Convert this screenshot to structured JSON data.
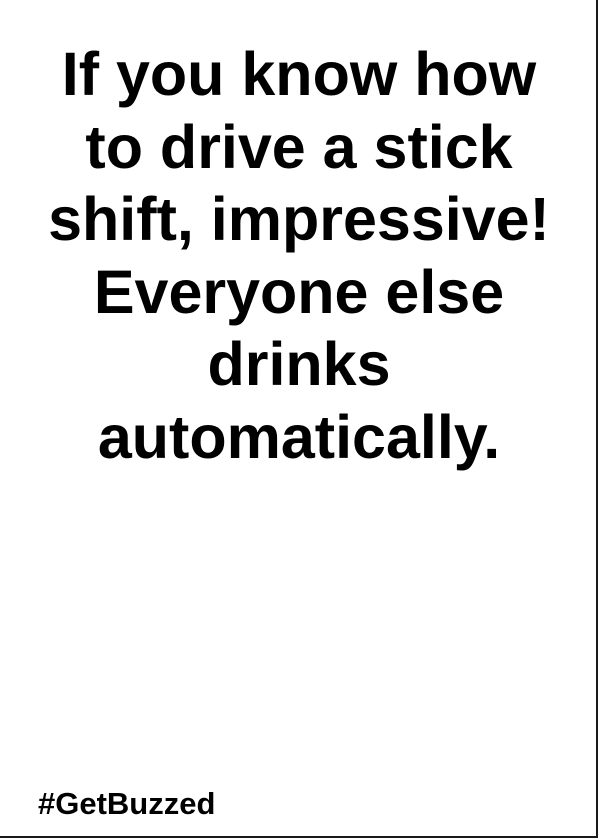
{
  "card": {
    "text_lines": [
      "If you know how",
      "to drive a stick",
      "shift, impressive!",
      "Everyone else",
      "drinks",
      "automatically."
    ],
    "hashtag": "#GetBuzzed"
  },
  "colors": {
    "background": "#ffffff",
    "text": "#000000",
    "border": "#1a1a1a"
  }
}
